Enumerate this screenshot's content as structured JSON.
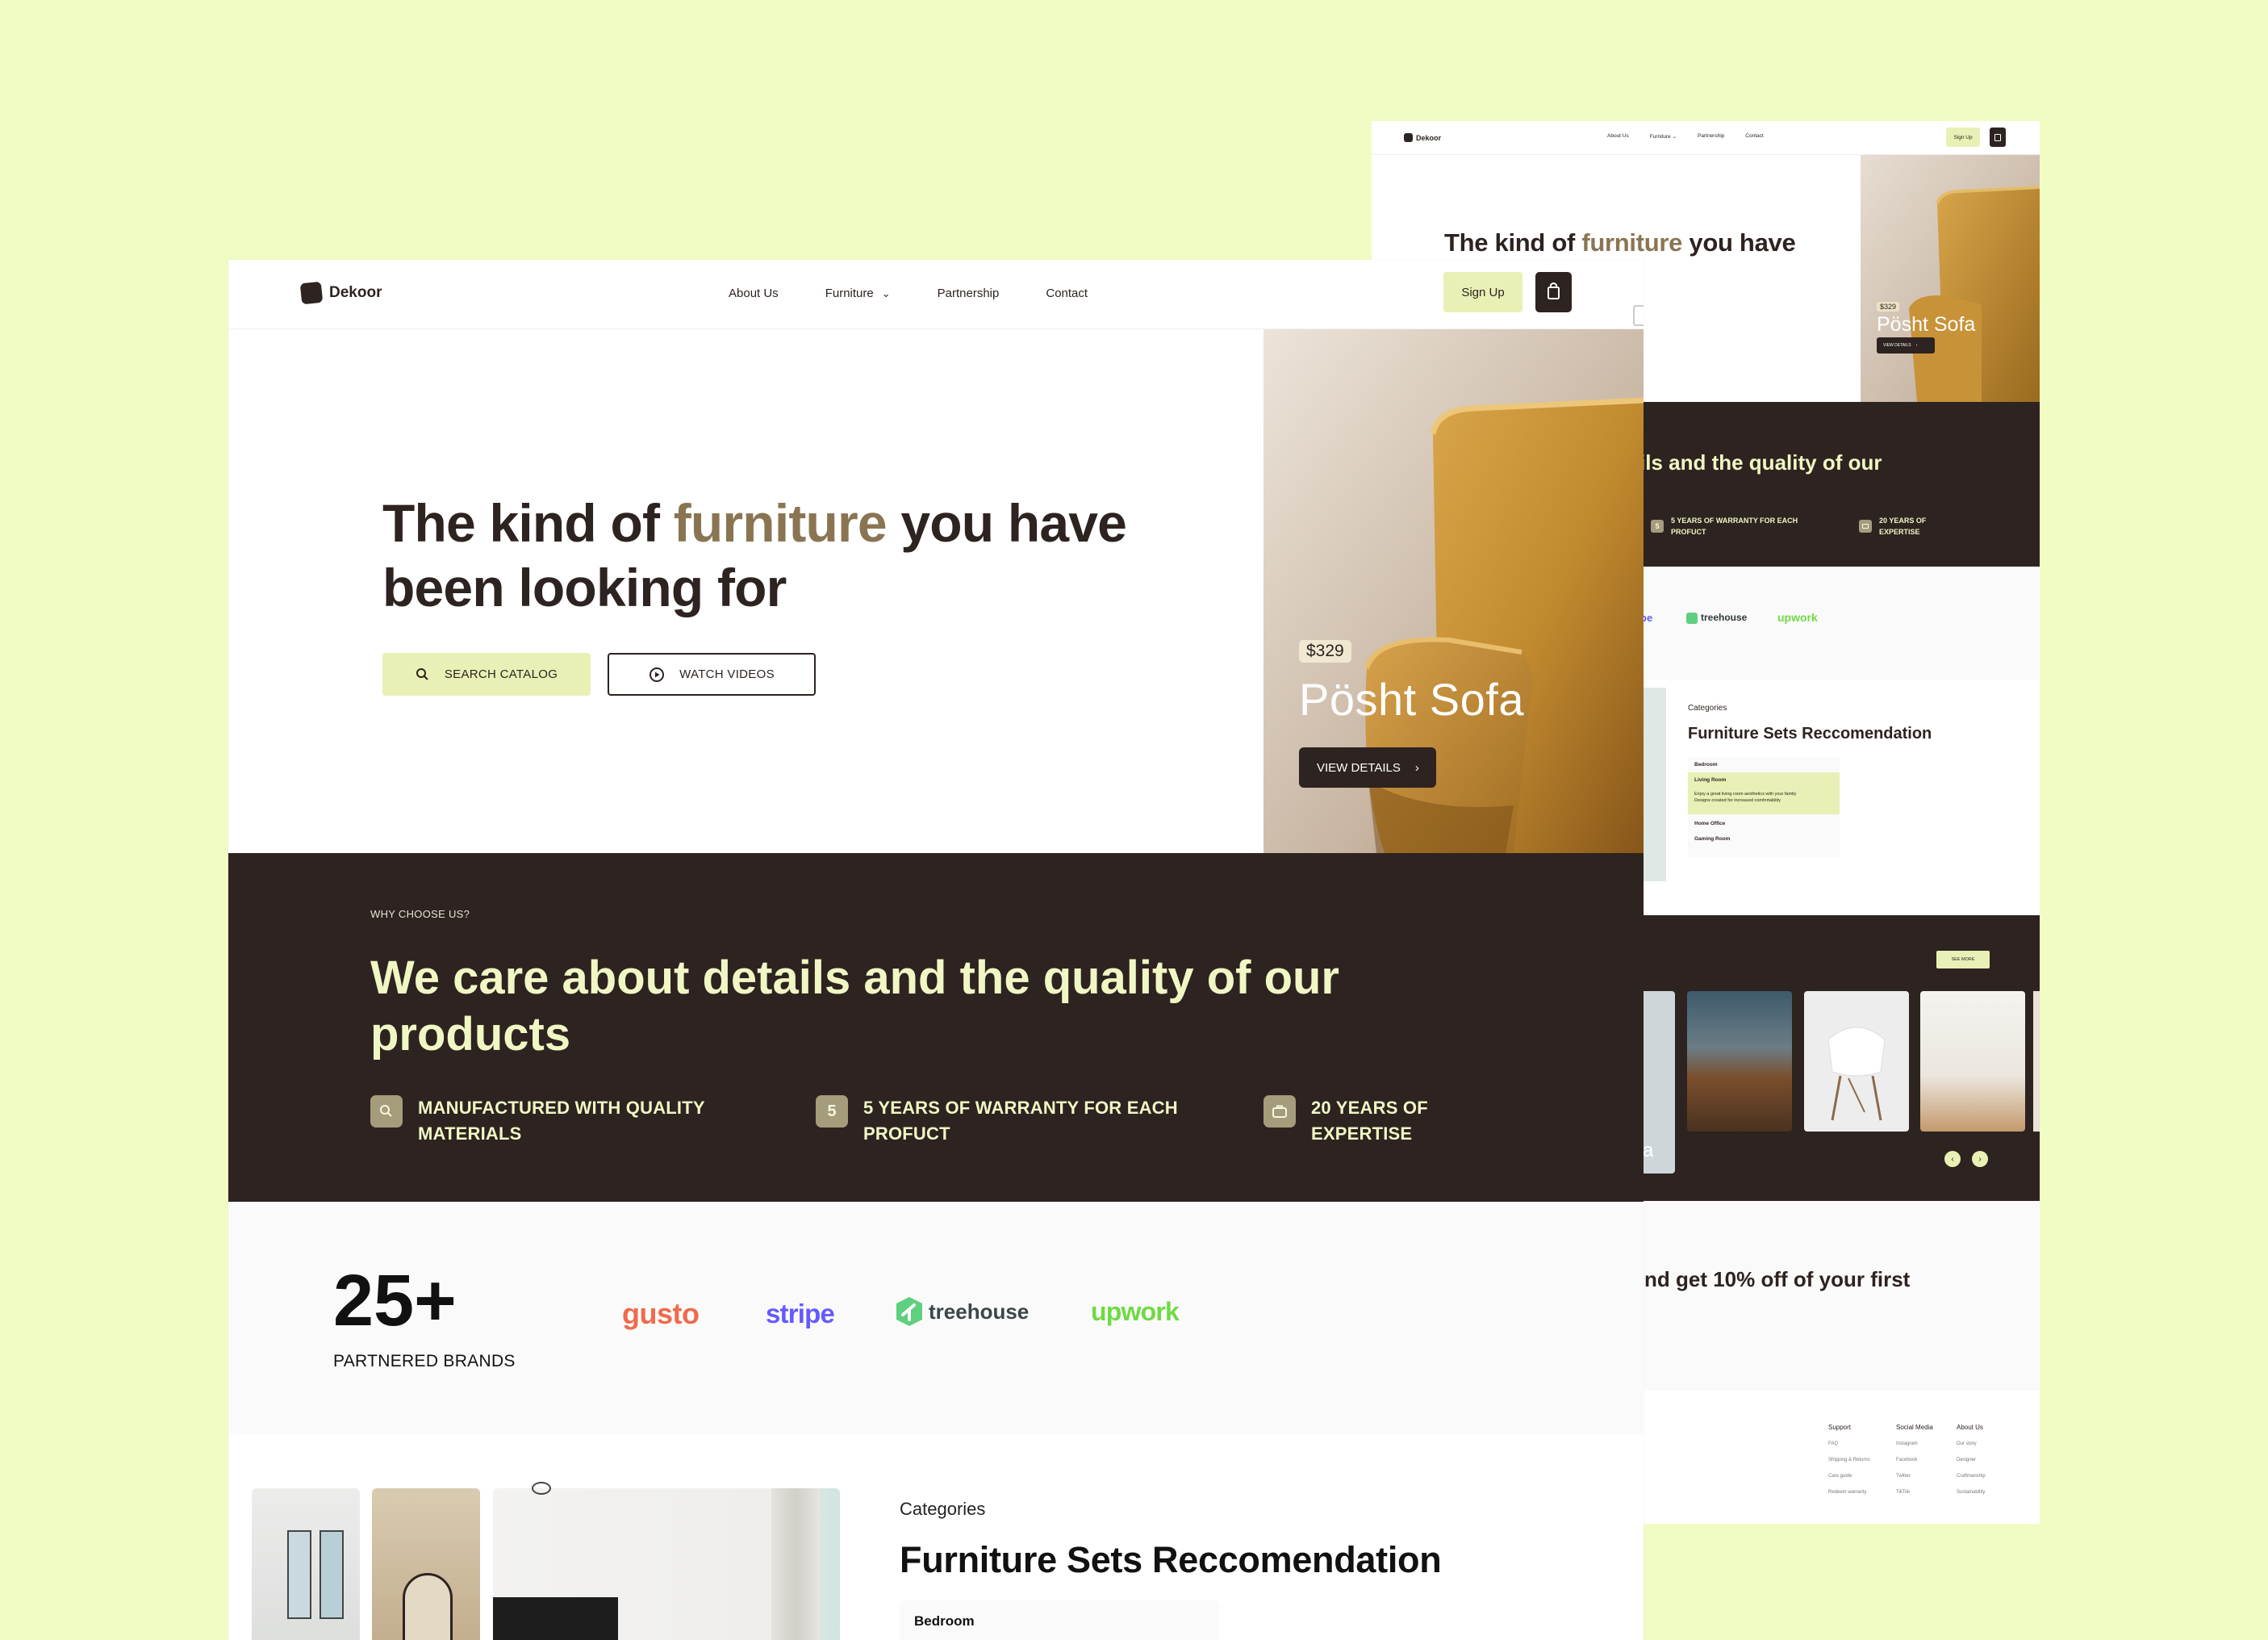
{
  "main_page": {
    "nav": {
      "brand": "Dekoor",
      "links": [
        "About Us",
        "Furniture",
        "Partnership",
        "Contact"
      ],
      "signup": "Sign Up"
    },
    "hero": {
      "title_part1": "The kind of ",
      "title_highlight": "furniture",
      "title_part2": " you have",
      "title_line2": "been looking for",
      "search_btn": "SEARCH CATALOG",
      "watch_btn": "WATCH VIDEOS",
      "product": {
        "price": "$329",
        "name": "Pösht Sofa",
        "details_btn": "VIEW DETAILS"
      }
    },
    "why": {
      "eyebrow": "WHY CHOOSE US?",
      "heading_line1": "We care about details and the quality of our",
      "heading_line2": "products",
      "features": [
        {
          "line1": "MANUFACTURED WITH QUALITY",
          "line2": "MATERIALS"
        },
        {
          "icon_text": "5",
          "line1": "5 YEARS OF WARRANTY FOR EACH",
          "line2": "PROFUCT"
        },
        {
          "line1": "20 YEARS OF",
          "line2": "EXPERTISE"
        }
      ]
    },
    "brands": {
      "count": "25+",
      "label": "PARTNERED BRANDS",
      "logos": [
        "gusto",
        "stripe",
        "treehouse",
        "upwork"
      ]
    },
    "categories": {
      "eyebrow": "Categories",
      "heading": "Furniture Sets Reccomendation",
      "first_item": "Bedroom"
    }
  },
  "side_page": {
    "nav": {
      "brand": "Dekoor",
      "links": [
        "About Us",
        "Furniture",
        "Partnership",
        "Contact"
      ],
      "signup": "Sign Up"
    },
    "hero": {
      "title_part1": "The kind of ",
      "title_highlight": "furniture",
      "title_part2": " you have",
      "price": "$329",
      "product": "Pösht Sofa",
      "details": "VIEW DETAILS"
    },
    "why_heading_fragment": "ils and the quality of our",
    "features": [
      {
        "icon_text": "5",
        "line1": "5 YEARS OF WARRANTY FOR EACH",
        "line2": "PROFUCT"
      },
      {
        "line1": "20 YEARS OF",
        "line2": "EXPERTISE"
      }
    ],
    "brand_fragment": "pe",
    "logos": [
      "treehouse",
      "upwork"
    ],
    "categories": {
      "eyebrow": "Categories",
      "heading": "Furniture Sets Reccomendation",
      "items": [
        "Bedroom",
        "Living Room",
        "Home Office",
        "Gaming Room"
      ],
      "active_desc_line1": "Enjoy a great living room aesthetics with your family",
      "active_desc_line2": "Designs created for increased comfortability"
    },
    "see_more": "SEE MORE",
    "newsletter_fragment": "nd get 10% off of your first",
    "image_fragment_letter": "a",
    "footer": {
      "columns": [
        {
          "title": "Support",
          "items": [
            "FAQ",
            "Shipping & Returns",
            "Care guide",
            "Redeem warranty"
          ]
        },
        {
          "title": "Social Media",
          "items": [
            "Instagram",
            "Facebook",
            "Twitter",
            "TikTok"
          ]
        },
        {
          "title": "About Us",
          "items": [
            "Our story",
            "Designer",
            "Craftmanship",
            "Sustainability"
          ]
        }
      ]
    }
  },
  "colors": {
    "background": "#f0fcc4",
    "dark": "#2d2320",
    "accent_gold": "#8a7553",
    "lime": "#e9f0b5",
    "lime_text": "#f0f7c4"
  }
}
